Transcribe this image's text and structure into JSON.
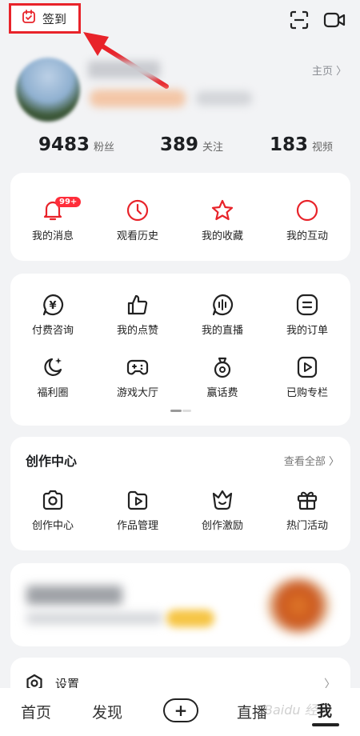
{
  "topbar": {
    "checkin_label": "签到",
    "scan_icon": "scan-icon",
    "video_icon": "video-camera-icon",
    "highlight_color": "#e8232a"
  },
  "profile": {
    "homepage_label": "主页 〉",
    "stats": [
      {
        "num": "9483",
        "unit": "粉丝"
      },
      {
        "num": "389",
        "unit": "关注"
      },
      {
        "num": "183",
        "unit": "视频"
      }
    ]
  },
  "quick_actions": [
    {
      "label": "我的消息",
      "icon": "bell-icon",
      "badge": "99+"
    },
    {
      "label": "观看历史",
      "icon": "clock-icon"
    },
    {
      "label": "我的收藏",
      "icon": "star-icon"
    },
    {
      "label": "我的互动",
      "icon": "circle-icon"
    }
  ],
  "services": [
    {
      "label": "付费咨询",
      "icon": "yen-chat-icon"
    },
    {
      "label": "我的点赞",
      "icon": "thumbs-up-icon"
    },
    {
      "label": "我的直播",
      "icon": "live-audio-icon"
    },
    {
      "label": "我的订单",
      "icon": "order-list-icon"
    },
    {
      "label": "福利圈",
      "icon": "moon-sparkle-icon"
    },
    {
      "label": "游戏大厅",
      "icon": "gamepad-icon"
    },
    {
      "label": "赢话费",
      "icon": "money-bag-icon"
    },
    {
      "label": "已购专栏",
      "icon": "play-document-icon"
    }
  ],
  "creation": {
    "title": "创作中心",
    "view_all": "查看全部 〉",
    "items": [
      {
        "label": "创作中心",
        "icon": "camera-icon"
      },
      {
        "label": "作品管理",
        "icon": "folder-play-icon"
      },
      {
        "label": "创作激励",
        "icon": "crown-icon"
      },
      {
        "label": "热门活动",
        "icon": "gift-icon"
      }
    ]
  },
  "settings": {
    "label": "设置",
    "chevron": "〉"
  },
  "bottom_nav": {
    "home": "首页",
    "discover": "发现",
    "plus": "+",
    "live": "直播",
    "me": "我",
    "watermark": "Baidu 经验"
  },
  "colors": {
    "accent_red": "#e8232a",
    "badge_red": "#ff2d3a"
  }
}
